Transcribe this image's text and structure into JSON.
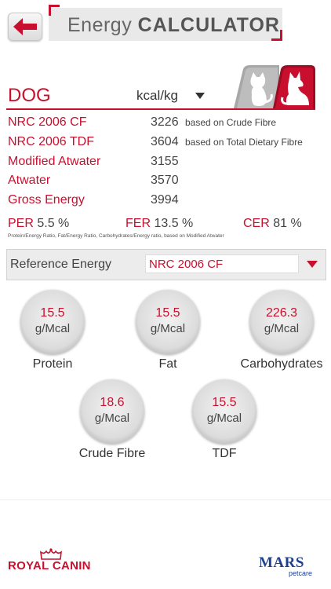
{
  "header": {
    "title_light": "Energy",
    "title_bold": "CALCULATOR",
    "back_icon": "back-arrow-icon"
  },
  "species": {
    "selected": "DOG",
    "unit": "kcal/kg",
    "tabs": [
      "cat",
      "dog"
    ],
    "active_tab": "dog"
  },
  "results": [
    {
      "label": "NRC 2006 CF",
      "value": "3226",
      "note": "based on Crude Fibre"
    },
    {
      "label": "NRC 2006 TDF",
      "value": "3604",
      "note": "based on Total Dietary Fibre"
    },
    {
      "label": "Modified Atwater",
      "value": "3155",
      "note": ""
    },
    {
      "label": "Atwater",
      "value": "3570",
      "note": ""
    },
    {
      "label": "Gross Energy",
      "value": "3994",
      "note": ""
    }
  ],
  "ratios": {
    "per_label": "PER",
    "per_value": "5.5 %",
    "fer_label": "FER",
    "fer_value": "13.5 %",
    "cer_label": "CER",
    "cer_value": "81 %",
    "note": "Protein/Energy Ratio, Fat/Energy Ratio, Carbohydrates/Energy ratio, based on Modified Atwater"
  },
  "reference": {
    "label": "Reference Energy",
    "value": "NRC 2006 CF"
  },
  "nutrients": [
    {
      "value": "15.5",
      "unit": "g/Mcal",
      "caption": "Protein"
    },
    {
      "value": "15.5",
      "unit": "g/Mcal",
      "caption": "Fat"
    },
    {
      "value": "226.3",
      "unit": "g/Mcal",
      "caption": "Carbohydrates"
    },
    {
      "value": "18.6",
      "unit": "g/Mcal",
      "caption": "Crude Fibre"
    },
    {
      "value": "15.5",
      "unit": "g/Mcal",
      "caption": "TDF"
    }
  ],
  "footer": {
    "left_logo": "ROYAL CANIN",
    "right_logo": "MARS",
    "right_logo_sub": "petcare"
  },
  "colors": {
    "brand_red": "#c8102e",
    "text_dark": "#444444",
    "mars_blue": "#1f3f8f"
  }
}
